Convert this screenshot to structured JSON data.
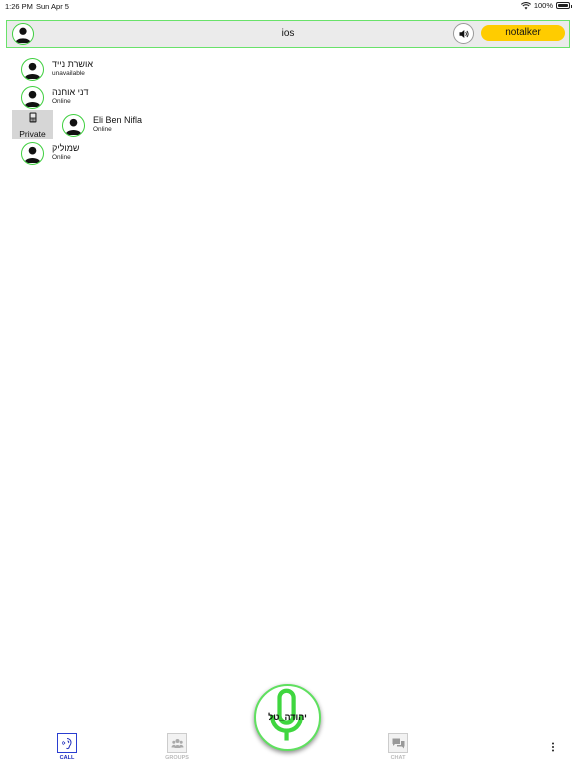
{
  "status_bar": {
    "time": "1:26 PM",
    "date": "Sun Apr 5",
    "battery": "100%"
  },
  "header": {
    "title": "ios",
    "talker_label": "notalker"
  },
  "contacts": [
    {
      "name": "אושרת נייד",
      "status": "unavailable"
    },
    {
      "name": "דני אוחנה",
      "status": "Online"
    },
    {
      "name": "Eli Ben Nifla",
      "status": "Online"
    },
    {
      "name": "שמוליק",
      "status": "Online"
    }
  ],
  "private_label": "Private",
  "ptt": {
    "user": "יהודה_טל"
  },
  "tabs": [
    {
      "label": "CALL",
      "active": true
    },
    {
      "label": "GROUPS",
      "active": false
    },
    {
      "label": "CHAT",
      "active": false
    }
  ],
  "colors": {
    "accent_green": "#5fe05f",
    "talker_yellow": "#ffcc00",
    "active_tab_blue": "#1f2dbb"
  }
}
